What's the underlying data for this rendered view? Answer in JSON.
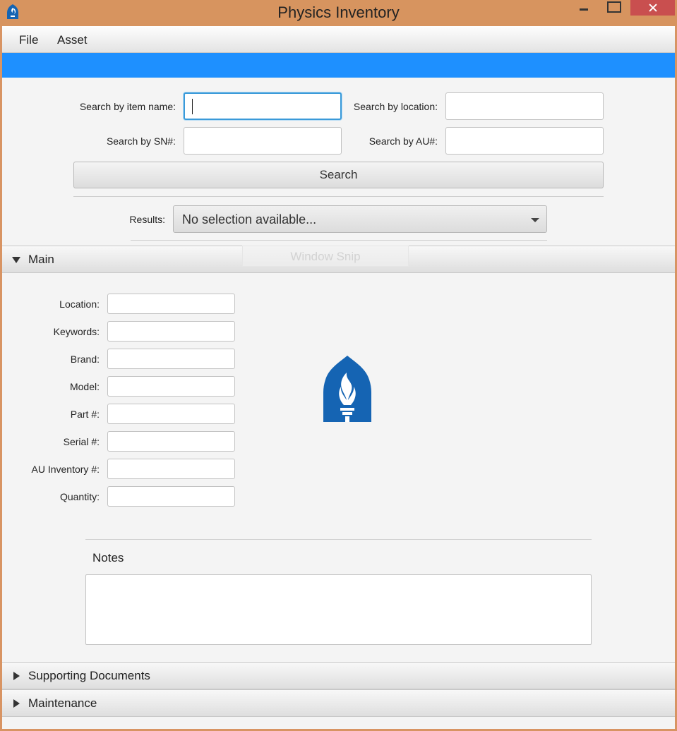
{
  "window": {
    "title": "Physics Inventory",
    "icon": "flame-logo-icon"
  },
  "menu": {
    "file": "File",
    "asset": "Asset"
  },
  "search": {
    "item_name_label": "Search by item name:",
    "item_name_value": "",
    "location_label": "Search by location:",
    "location_value": "",
    "sn_label": "Search by SN#:",
    "sn_value": "",
    "au_label": "Search by AU#:",
    "au_value": "",
    "button_label": "Search"
  },
  "results": {
    "label": "Results:",
    "selected": "No selection available..."
  },
  "overlay": {
    "ghost_text": "Window Snip"
  },
  "main_section": {
    "title": "Main",
    "fields": {
      "location": "Location:",
      "keywords": "Keywords:",
      "brand": "Brand:",
      "model": "Model:",
      "part": "Part #:",
      "serial": "Serial #:",
      "au_inventory": "AU Inventory #:",
      "quantity": "Quantity:"
    },
    "notes_label": "Notes"
  },
  "sections": {
    "supporting_documents": "Supporting Documents",
    "maintenance": "Maintenance"
  },
  "colors": {
    "title_bar": "#d7945f",
    "accent_blue": "#1e90ff",
    "logo_blue": "#1564b3",
    "close_red": "#c94f4f"
  }
}
